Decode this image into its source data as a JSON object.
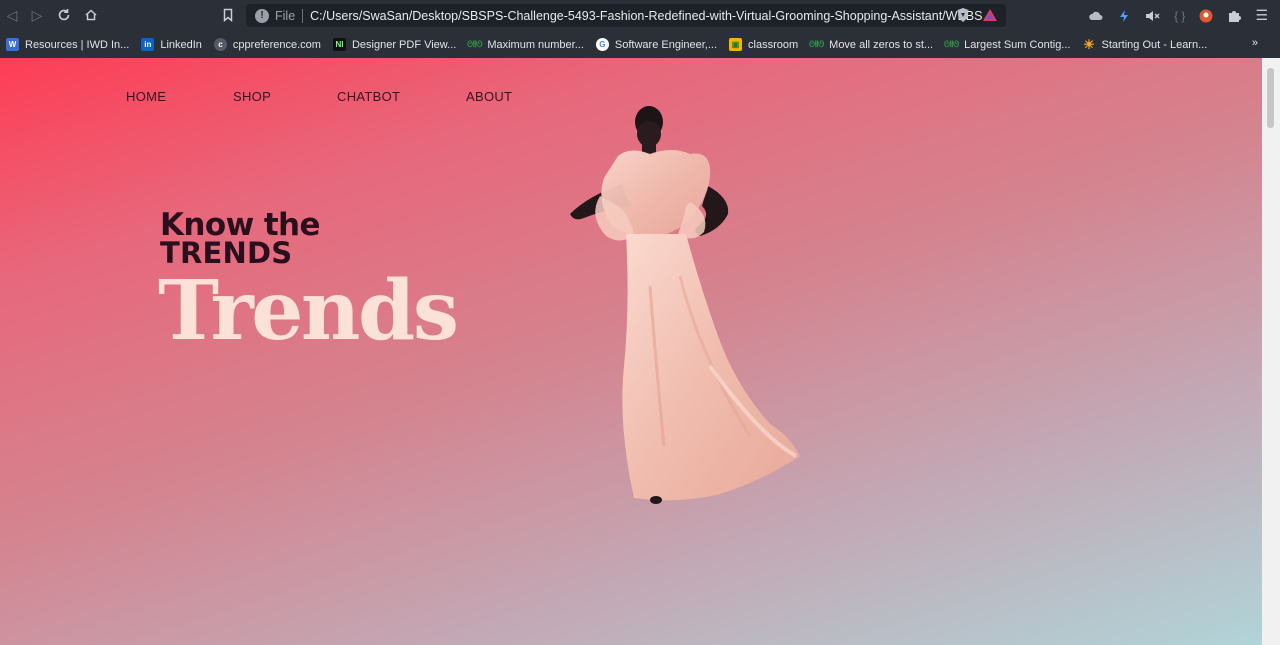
{
  "browser": {
    "url_scheme": "File",
    "url": "C:/Users/SwaSan/Desktop/SBSPS-Challenge-5493-Fashion-Redefined-with-Virtual-Grooming-Shopping-Assistant/WEBSIT...",
    "bookmarks": [
      {
        "label": "Resources | IWD In...",
        "icon": "iwd-icon",
        "color": "#3b6fd8"
      },
      {
        "label": "LinkedIn",
        "icon": "linkedin-icon",
        "color": "#0a66c2"
      },
      {
        "label": "cppreference.com",
        "icon": "cppreference-icon",
        "color": "#555b66"
      },
      {
        "label": "Designer PDF View...",
        "icon": "pdf-viewer-icon",
        "color": "#111111"
      },
      {
        "label": "Maximum number...",
        "icon": "geeksforgeeks-icon",
        "color": "#2f8d46"
      },
      {
        "label": "Software Engineer,...",
        "icon": "google-icon",
        "color": "#ffffff"
      },
      {
        "label": "classroom",
        "icon": "classroom-icon",
        "color": "#f4b400"
      },
      {
        "label": "Move all zeros to st...",
        "icon": "geeksforgeeks-icon",
        "color": "#2f8d46"
      },
      {
        "label": "Largest Sum Contig...",
        "icon": "geeksforgeeks-icon",
        "color": "#2f8d46"
      },
      {
        "label": "Starting Out - Learn...",
        "icon": "sun-icon",
        "color": "#f6a821"
      }
    ],
    "more_label": "»"
  },
  "nav": {
    "home": "HOME",
    "shop": "SHOP",
    "chatbot": "CHATBOT",
    "about": "ABOUT"
  },
  "hero": {
    "kicker_line1": "Know the",
    "kicker_line2": "TRENDS",
    "title": "Trends"
  },
  "colors": {
    "gradient_start": "#fe3d55",
    "gradient_end": "#b0d4d8",
    "kicker": "#2c0f1c",
    "title": "#fbe1d8",
    "dress": "#f2c1b4"
  }
}
